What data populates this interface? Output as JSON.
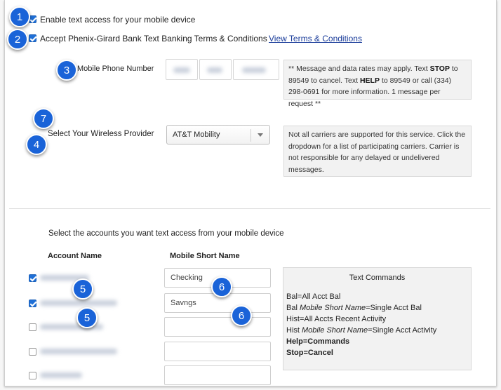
{
  "settings": {
    "enable_text_access": {
      "label": "Enable text access for your mobile device",
      "checked": true
    },
    "accept_terms": {
      "label": "Accept Phenix-Girard Bank Text Banking Terms & Conditions",
      "checked": true,
      "link": "View Terms & Conditions"
    },
    "mobile_phone": {
      "label": "Mobile Phone Number",
      "note_parts": [
        "** Message and data rates may apply. Text ",
        "STOP",
        " to 89549 to cancel. Text ",
        "HELP",
        " to 89549 or call (334) 298-0691 for more information. 1 message per request **"
      ]
    },
    "wireless_provider": {
      "label": "Select Your Wireless Provider",
      "selected": "AT&T Mobility",
      "note": "Not all carriers are supported for this service. Click the dropdown for a list of participating carriers. Carrier is not responsible for any delayed or undelivered messages."
    }
  },
  "accounts": {
    "heading": "Select the accounts you want text access from your mobile device",
    "col_account": "Account Name",
    "col_short": "Mobile Short Name",
    "rows": [
      {
        "checked": true,
        "short_name": "Checking"
      },
      {
        "checked": true,
        "short_name": "Savngs"
      },
      {
        "checked": false,
        "short_name": ""
      },
      {
        "checked": false,
        "short_name": ""
      },
      {
        "checked": false,
        "short_name": ""
      }
    ],
    "commands": {
      "title": "Text Commands",
      "line1": "Bal=All Acct Bal",
      "line2_a": "Bal ",
      "line2_b": "Mobile Short Name",
      "line2_c": "=Single Acct Bal",
      "line3": "Hist=All Accts Recent Activity",
      "line4_a": "Hist ",
      "line4_b": "Mobile Short Name",
      "line4_c": "=Single Acct Activity",
      "line5": "Help=Commands",
      "line6": "Stop=Cancel"
    }
  },
  "callouts": [
    "1",
    "2",
    "3",
    "7",
    "4",
    "5",
    "5",
    "6",
    "6"
  ],
  "colors": {
    "accent": "#1a63d8",
    "link": "#1a3c9a",
    "checkbox": "#1f6fd6"
  }
}
